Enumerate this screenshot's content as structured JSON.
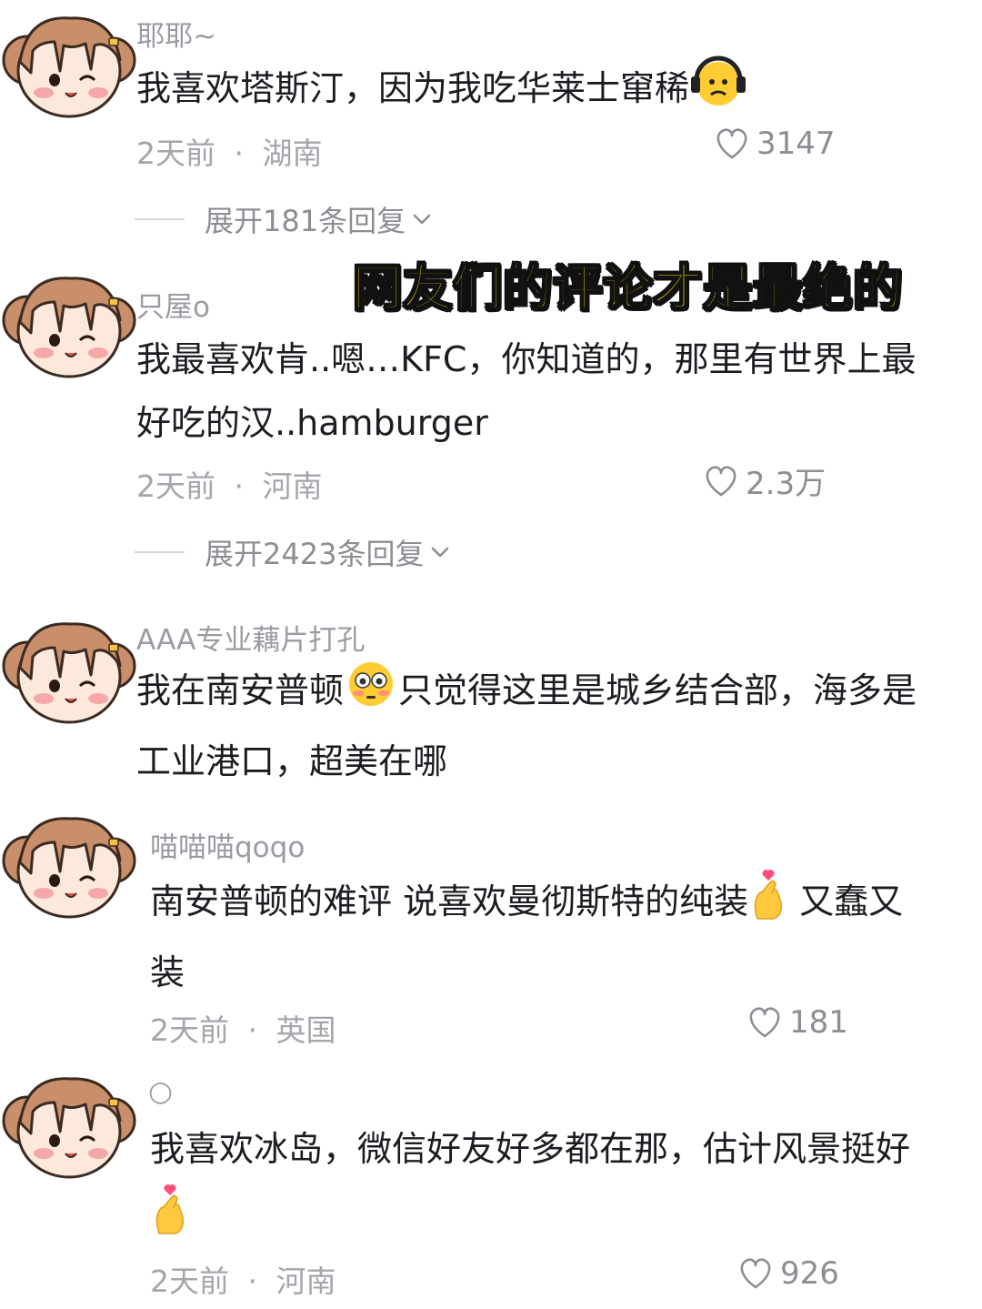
{
  "overlay_caption": "网友们的评论才是最绝的",
  "comments": [
    {
      "username": "耶耶~",
      "text_before": "我喜欢塔斯汀，因为我吃华莱士窜稀",
      "emoji": "headphones-face-emoji",
      "text_after": "",
      "time": "2天前",
      "location": "湖南",
      "meta_sep": "·",
      "likes": "3147",
      "replies": "展开181条回复"
    },
    {
      "username": "只屋o",
      "text_before": "我最喜欢肯..嗯…KFC，你知道的，那里有世界上最好吃的汉..hamburger",
      "emoji": "",
      "text_after": "",
      "time": "2天前",
      "location": "河南",
      "meta_sep": "·",
      "likes": "2.3万",
      "replies": "展开2423条回复"
    },
    {
      "username": "AAA专业藕片打孔",
      "text_before": "我在南安普顿",
      "emoji": "flushed-face-emoji",
      "text_after": "只觉得这里是城乡结合部，海多是工业港口，超美在哪"
    },
    {
      "username": "喵喵喵qoqo",
      "text_before": "南安普顿的难评 说喜欢曼彻斯特的纯装",
      "emoji": "finger-heart-emoji",
      "text_after": " 又蠢又装",
      "time": "2天前",
      "location": "英国",
      "meta_sep": "·",
      "likes": "181"
    },
    {
      "username": "○",
      "text_before": "我喜欢冰岛，微信好友好多都在那，估计风景挺好",
      "emoji": "finger-heart-emoji",
      "text_after": "",
      "time": "2天前",
      "location": "河南",
      "meta_sep": "·",
      "likes": "926"
    }
  ],
  "colors": {
    "overlay_fill": "#ffe000",
    "overlay_stroke": "#111111",
    "meta_gray": "#a4a6ac",
    "text_dark": "#1c1d22"
  }
}
